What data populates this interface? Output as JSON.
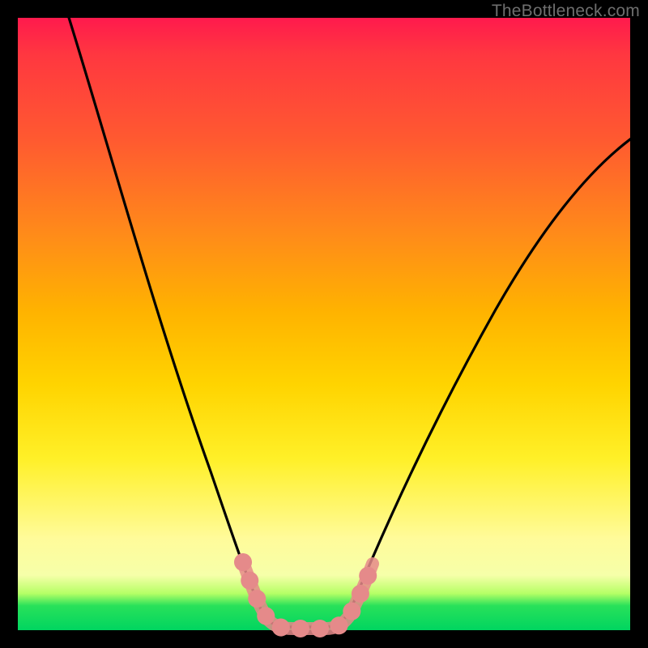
{
  "watermark": "TheBottleneck.com",
  "chart_data": {
    "type": "line",
    "title": "",
    "xlabel": "",
    "ylabel": "",
    "xlim": [
      0,
      100
    ],
    "ylim": [
      0,
      100
    ],
    "grid": false,
    "legend": false,
    "background_gradient": [
      "#ff1a4d",
      "#ff8a1a",
      "#ffd400",
      "#fffb9a",
      "#00d560"
    ],
    "series": [
      {
        "name": "bottleneck-curve",
        "stroke": "#000000",
        "x": [
          10,
          15,
          20,
          25,
          30,
          35,
          38,
          40,
          43,
          45,
          48,
          50,
          55,
          60,
          65,
          70,
          80,
          90,
          100
        ],
        "values": [
          100,
          82,
          65,
          50,
          36,
          22,
          12,
          5,
          1,
          0,
          0,
          1,
          5,
          12,
          22,
          32,
          48,
          60,
          70
        ]
      },
      {
        "name": "highlight-band",
        "stroke": "#e58a8a",
        "x": [
          37,
          38,
          39,
          40,
          41,
          42,
          43,
          44,
          45,
          46,
          47,
          48,
          49,
          50,
          51,
          52
        ],
        "values": [
          15,
          11,
          8,
          5,
          3,
          2,
          1,
          0,
          0,
          0,
          0,
          1,
          2,
          3,
          6,
          10
        ]
      }
    ]
  }
}
